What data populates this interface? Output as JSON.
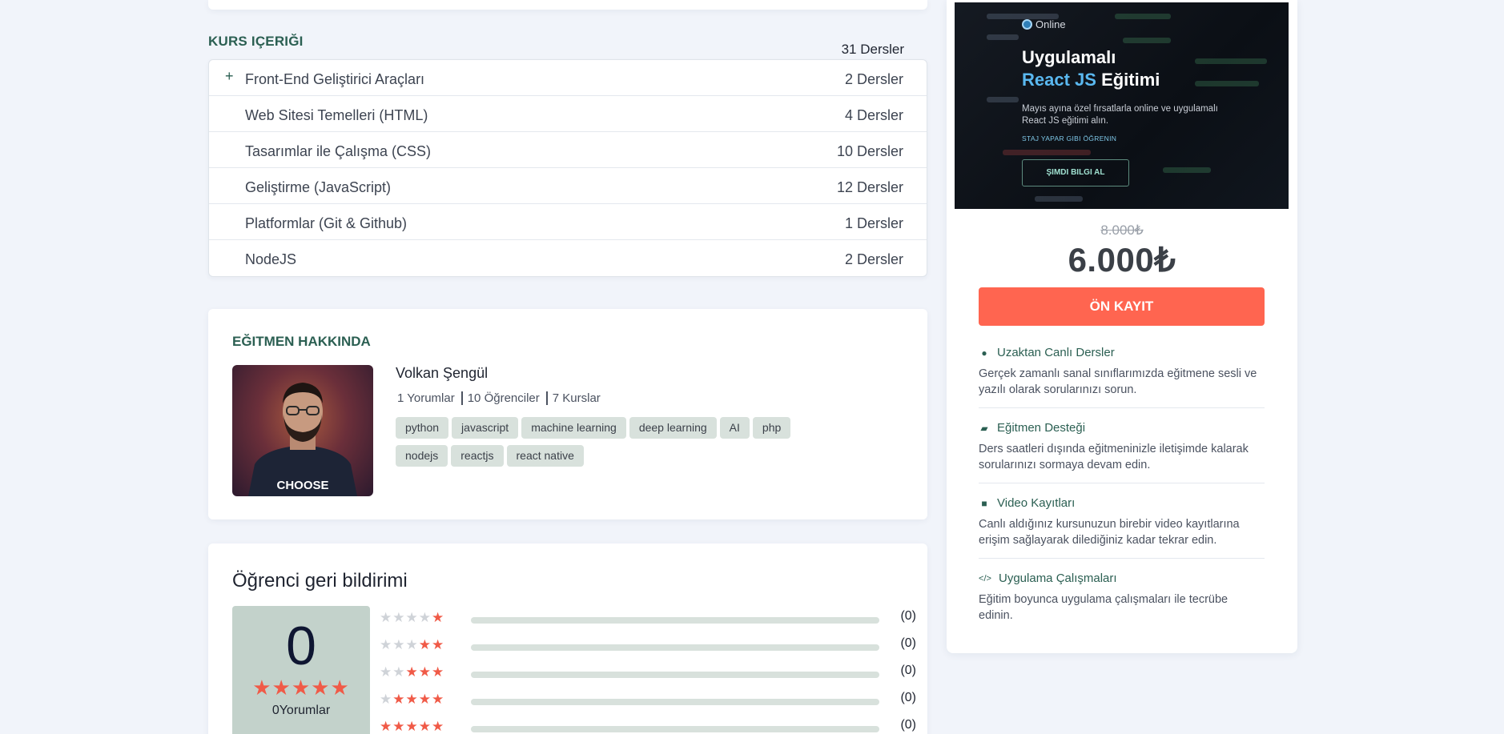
{
  "curriculum": {
    "title": "KURS IÇERIĞI",
    "total": "31 Dersler",
    "sections": [
      {
        "plus": "+",
        "name": "Front-End Geliştirici Araçları",
        "count": "2 Dersler"
      },
      {
        "plus": "",
        "name": "Web Sitesi Temelleri (HTML)",
        "count": "4 Dersler"
      },
      {
        "plus": "",
        "name": "Tasarımlar ile Çalışma (CSS)",
        "count": "10 Dersler"
      },
      {
        "plus": "",
        "name": "Geliştirme (JavaScript)",
        "count": "12 Dersler"
      },
      {
        "plus": "",
        "name": "Platformlar (Git & Github)",
        "count": "1 Dersler"
      },
      {
        "plus": "",
        "name": "NodeJS",
        "count": "2 Dersler"
      }
    ]
  },
  "instructor": {
    "title": "EĞITMEN HAKKINDA",
    "name": "Volkan Şengül",
    "stats": [
      "1 Yorumlar",
      "10 Öğrenciler",
      "7 Kurslar"
    ],
    "shirt_text": "CHOOSE",
    "tags": [
      "python",
      "javascript",
      "machine learning",
      "deep learning",
      "AI",
      "php",
      "nodejs",
      "reactjs",
      "react native"
    ]
  },
  "feedback": {
    "title": "Öğrenci geri bildirimi",
    "score": "0",
    "score_stars": "★★★★★",
    "reviews": "0Yorumlar",
    "rows": [
      {
        "filled": 1,
        "count": "(0)"
      },
      {
        "filled": 2,
        "count": "(0)"
      },
      {
        "filled": 3,
        "count": "(0)"
      },
      {
        "filled": 4,
        "count": "(0)"
      },
      {
        "filled": 5,
        "count": "(0)"
      }
    ]
  },
  "banner": {
    "online": "Online",
    "line1": "Uygulamalı",
    "accent": "React JS",
    "line2_rest": " Eğitimi",
    "desc": "Mayıs ayına özel fırsatlarla online ve uygulamalı React JS eğitimi alın.",
    "small": "STAJ YAPAR GIBI ÖĞRENIN",
    "button": "ŞIMDI BILGI AL"
  },
  "pricing": {
    "old": "8.000₺",
    "new": "6.000₺",
    "enroll": "ÖN KAYIT"
  },
  "features": [
    {
      "icon": "info-icon",
      "glyph": "●",
      "title": "Uzaktan Canlı Dersler",
      "text": "Gerçek zamanlı sanal sınıflarımızda eğitmene sesli ve yazılı olarak sorularınızı sorun."
    },
    {
      "icon": "chat-icon",
      "glyph": "▰",
      "title": "Eğitmen Desteği",
      "text": "Ders saatleri dışında eğitmeninizle iletişimde kalarak sorularınızı sormaya devam edin."
    },
    {
      "icon": "video-icon",
      "glyph": "■",
      "title": "Video Kayıtları",
      "text": "Canlı aldığınız kursunuzun birebir video kayıtlarına erişim sağlayarak dilediğiniz kadar tekrar edin."
    },
    {
      "icon": "code-icon",
      "glyph": "</>",
      "title": "Uygulama Çalışmaları",
      "text": "Eğitim boyunca uygulama çalışmaları ile tecrübe edinin."
    }
  ],
  "colors": {
    "brand_green": "#2b5f52",
    "accent_red": "#ff6550",
    "tag_bg": "#d8e1dc"
  }
}
